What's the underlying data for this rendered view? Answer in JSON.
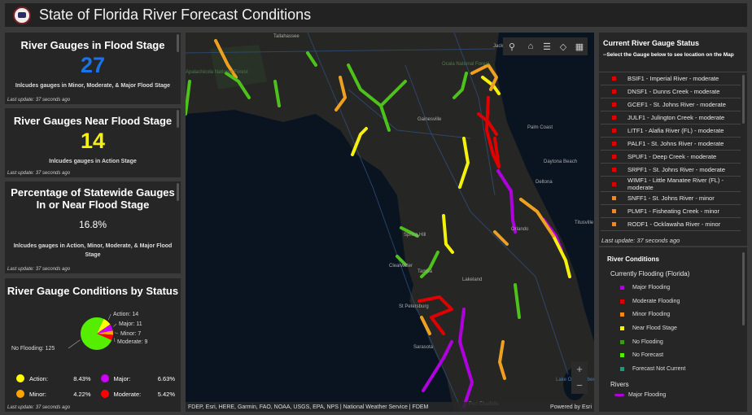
{
  "header": {
    "title": "State of Florida River Forecast Conditions"
  },
  "panels": {
    "flood": {
      "title": "River Gauges in Flood Stage",
      "value": "27",
      "desc": "Inlcudes gauges in Minor, Moderate, & Major Flood Stage",
      "update": "Last update: 37 seconds ago",
      "color": "#1a73e8"
    },
    "near": {
      "title": "River Gauges Near Flood Stage",
      "value": "14",
      "desc": "Inlcudes gauges in Action Stage",
      "update": "Last update: 37 seconds ago",
      "color": "#f5f10a"
    },
    "pct": {
      "title": "Percentage of Statewide Gauges In or Near Flood Stage",
      "value": "16.8%",
      "desc": "Inlcudes gauges in Action, Minor, Moderate, & Major Flood Stage",
      "update": "Last update: 37 seconds ago"
    },
    "status": {
      "title": "River Gauge Conditions by Status",
      "update": "Last update: 37 seconds ago"
    }
  },
  "chart_data": {
    "type": "pie",
    "title": "River Gauge Conditions by Status",
    "slices": [
      {
        "label": "Action",
        "value": 14,
        "color": "#ffff00",
        "display": "Action: 14"
      },
      {
        "label": "Major",
        "value": 11,
        "color": "#cc00ff",
        "display": "Major: 11"
      },
      {
        "label": "Minor",
        "value": 7,
        "color": "#ffa500",
        "display": "Minor: 7"
      },
      {
        "label": "Moderate",
        "value": 9,
        "color": "#ff0000",
        "display": "Moderate: 9"
      },
      {
        "label": "No Flooding",
        "value": 125,
        "color": "#55ee00",
        "display": "No Flooding: 125"
      }
    ],
    "legend": [
      {
        "label": "Action:",
        "pct": "8.43%",
        "color": "#ffff00"
      },
      {
        "label": "Major:",
        "pct": "6.63%",
        "color": "#cc00ff"
      },
      {
        "label": "Minor:",
        "pct": "4.22%",
        "color": "#ffa500"
      },
      {
        "label": "Moderate:",
        "pct": "5.42%",
        "color": "#ff0000"
      }
    ]
  },
  "map": {
    "attribution": "FDEP, Esri, HERE, Garmin, FAO, NOAA, USGS, EPA, NPS | National Weather Service | FDEM",
    "powered": "Powered by Esri",
    "labels": [
      "Tallahassee",
      "Jacksonville",
      "Gainesville",
      "Palm Coast",
      "Daytona Beach",
      "Deltona",
      "Orlando",
      "Titusville",
      "Spring Hill",
      "Clearwater",
      "Tampa",
      "St Petersburg",
      "Lakeland",
      "Sarasota",
      "Port Charlotte",
      "Apalachicola National Forest",
      "Ocala National Forest",
      "Lake Okeechobee"
    ]
  },
  "gauge_list": {
    "title": "Current River Gauge Status",
    "subtitle": "--Select the Gauge below to see location on the Map",
    "update": "Last update: 37 seconds ago",
    "items": [
      {
        "text": "BSIF1 - Imperial River - moderate",
        "color": "#e00000"
      },
      {
        "text": "DNSF1 - Dunns Creek - moderate",
        "color": "#e00000"
      },
      {
        "text": "GCEF1 - St. Johns River - moderate",
        "color": "#e00000"
      },
      {
        "text": "JULF1 - Julington Creek - moderate",
        "color": "#e00000"
      },
      {
        "text": "LITF1 - Alafia River (FL) - moderate",
        "color": "#e00000"
      },
      {
        "text": "PALF1 - St. Johns River - moderate",
        "color": "#e00000"
      },
      {
        "text": "SPUF1 - Deep Creek - moderate",
        "color": "#e00000"
      },
      {
        "text": "SRPF1 - St. Johns River - moderate",
        "color": "#e00000"
      },
      {
        "text": "WIMF1 - Little Manatee River (FL) - moderate",
        "color": "#e00000"
      },
      {
        "text": "SNFF1 - St. Johns River - minor",
        "color": "#f08a1c"
      },
      {
        "text": "PLMF1 - Fisheating Creek - minor",
        "color": "#f08a1c"
      },
      {
        "text": "RODF1 - Ocklawaha River - minor",
        "color": "#f08a1c"
      }
    ]
  },
  "legend": {
    "title": "River Conditions",
    "group1": "Currently Flooding (Florida)",
    "items": [
      {
        "label": "Major Flooding",
        "color": "#b000e0"
      },
      {
        "label": "Moderate Flooding",
        "color": "#e00000"
      },
      {
        "label": "Minor Flooding",
        "color": "#f08a1c"
      },
      {
        "label": "Near Flood Stage",
        "color": "#f5f10a"
      },
      {
        "label": "No Flooding",
        "color": "#3a9a20"
      },
      {
        "label": "No Forecast",
        "color": "#55ee00"
      },
      {
        "label": "Forecast Not Current",
        "color": "#1a9a7a"
      }
    ],
    "group2": "Rivers",
    "rivers": [
      {
        "label": "Major Flooding",
        "color": "#b000e0"
      }
    ]
  }
}
